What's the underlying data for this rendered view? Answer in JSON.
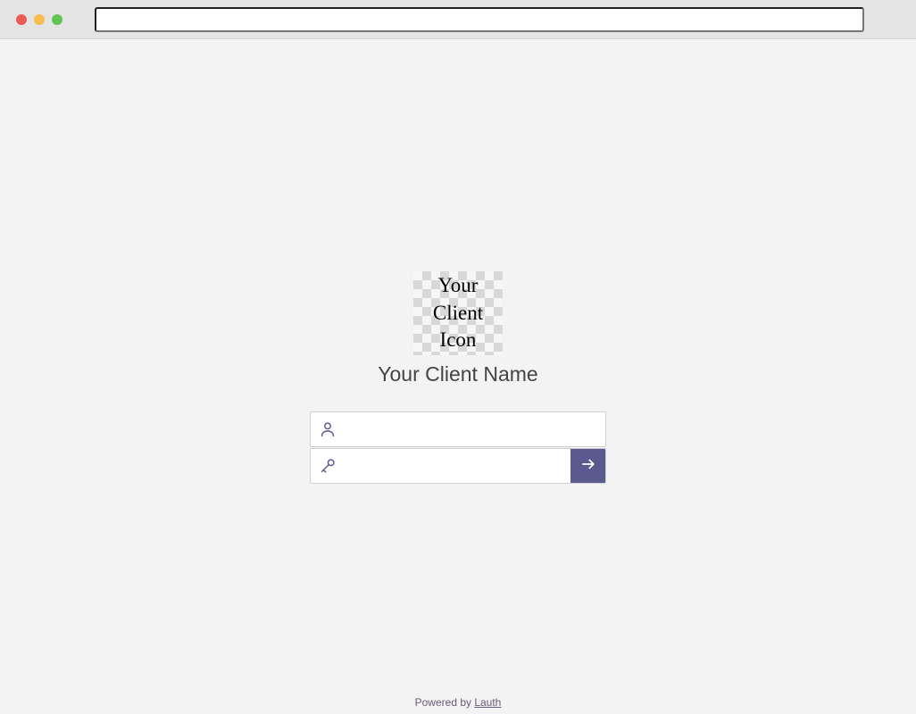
{
  "chrome": {
    "address_value": ""
  },
  "login": {
    "client_icon_text": "Your\nClient\nIcon",
    "client_name": "Your Client Name",
    "username": {
      "value": "",
      "placeholder": ""
    },
    "password": {
      "value": "",
      "placeholder": ""
    }
  },
  "footer": {
    "prefix": "Powered by ",
    "link_text": "Lauth"
  },
  "colors": {
    "accent": "#5a5a8e"
  }
}
